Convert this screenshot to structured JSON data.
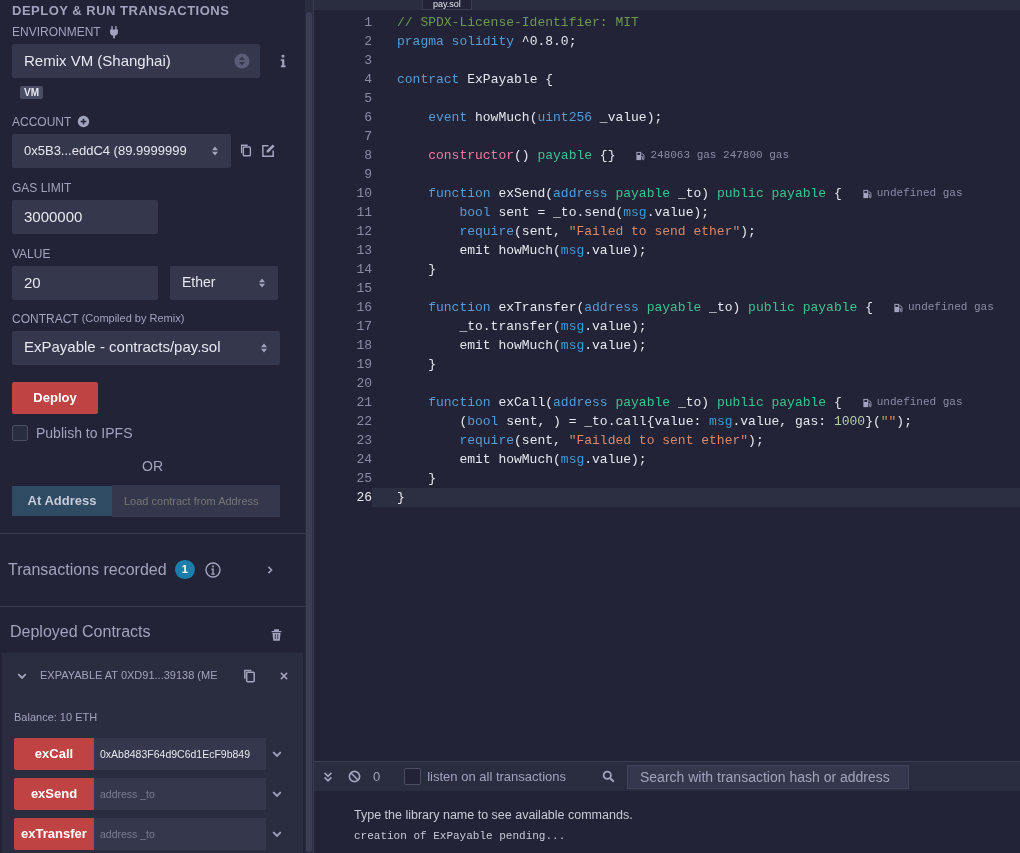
{
  "panel_title": "DEPLOY & RUN TRANSACTIONS",
  "environment": {
    "label": "ENVIRONMENT",
    "value": "Remix VM (Shanghai)",
    "badge": "VM"
  },
  "account": {
    "label": "ACCOUNT",
    "value": "0x5B3...eddC4 (89.9999999"
  },
  "gas_limit": {
    "label": "GAS LIMIT",
    "value": "3000000"
  },
  "value": {
    "label": "VALUE",
    "amount": "20",
    "unit": "Ether"
  },
  "contract": {
    "label": "CONTRACT",
    "note": "(Compiled by Remix)",
    "value": "ExPayable - contracts/pay.sol"
  },
  "deploy_button": "Deploy",
  "publish": {
    "label": "Publish to IPFS",
    "checked": false
  },
  "or_text": "OR",
  "at_address": {
    "button": "At Address",
    "placeholder": "Load contract from Address"
  },
  "transactions_recorded": {
    "label": "Transactions recorded",
    "count": "1"
  },
  "deployed": {
    "title": "Deployed Contracts",
    "instance": {
      "title": "EXPAYABLE AT 0XD91...39138 (ME",
      "expanded": true,
      "balance": "Balance: 10 ETH",
      "functions": [
        {
          "name": "exCall",
          "value": "0xAb8483F64d9C6d1EcF9b849"
        },
        {
          "name": "exSend",
          "placeholder": "address _to"
        },
        {
          "name": "exTransfer",
          "placeholder": "address _to"
        }
      ]
    }
  },
  "tabs": [
    {
      "label": "pay.sol",
      "selected": true
    }
  ],
  "editor": {
    "lines": [
      {
        "number": "1",
        "active": false,
        "tokens": [
          {
            "kind": "comment",
            "text": "// SPDX-License-Identifier: MIT"
          }
        ]
      },
      {
        "number": "2",
        "active": false,
        "tokens": [
          {
            "kind": "kw",
            "text": "pragma"
          },
          {
            "kind": "kw",
            "text": " solidity"
          },
          {
            "kind": "plain",
            "text": " ^0.8.0;"
          }
        ]
      },
      {
        "number": "3",
        "active": false
      },
      {
        "number": "4",
        "active": false,
        "tokens": [
          {
            "kind": "kw",
            "text": "contract"
          },
          {
            "kind": "plain",
            "text": " ExPayable {"
          }
        ]
      },
      {
        "number": "5",
        "active": false
      },
      {
        "number": "6",
        "active": false,
        "tokens": [
          {
            "kind": "kw",
            "text": "    event"
          },
          {
            "kind": "plain",
            "text": " howMuch("
          },
          {
            "kind": "kw",
            "text": "uint256"
          },
          {
            "kind": "plain",
            "text": " _value);"
          }
        ]
      },
      {
        "number": "7",
        "active": false
      },
      {
        "number": "8",
        "active": false,
        "tokens": [
          {
            "kind": "ctor",
            "text": "    constructor"
          },
          {
            "kind": "plain",
            "text": "() "
          },
          {
            "kind": "mod",
            "text": "payable"
          },
          {
            "kind": "plain",
            "text": " {}"
          }
        ],
        "gas": "248063 gas 247800 gas"
      },
      {
        "number": "9",
        "active": false
      },
      {
        "number": "10",
        "active": false,
        "tokens": [
          {
            "kind": "kw",
            "text": "    function"
          },
          {
            "kind": "plain",
            "text": " exSend("
          },
          {
            "kind": "kw",
            "text": "address"
          },
          {
            "kind": "mod",
            "text": " payable"
          },
          {
            "kind": "plain",
            "text": " _to) "
          },
          {
            "kind": "mod",
            "text": "public"
          },
          {
            "kind": "mod",
            "text": " payable"
          },
          {
            "kind": "plain",
            "text": " {"
          }
        ],
        "gas": "undefined gas"
      },
      {
        "number": "11",
        "active": false,
        "tokens": [
          {
            "kind": "kw",
            "text": "        bool"
          },
          {
            "kind": "plain",
            "text": " sent = _to.send("
          },
          {
            "kind": "var",
            "text": "msg"
          },
          {
            "kind": "plain",
            "text": ".value);"
          }
        ]
      },
      {
        "number": "12",
        "active": false,
        "tokens": [
          {
            "kind": "kw",
            "text": "        require"
          },
          {
            "kind": "plain",
            "text": "(sent, "
          },
          {
            "kind": "str",
            "text": "\"Failed to send ether\""
          },
          {
            "kind": "plain",
            "text": ");"
          }
        ]
      },
      {
        "number": "13",
        "active": false,
        "tokens": [
          {
            "kind": "plain",
            "text": "        emit howMuch("
          },
          {
            "kind": "var",
            "text": "msg"
          },
          {
            "kind": "plain",
            "text": ".value);"
          }
        ]
      },
      {
        "number": "14",
        "active": false,
        "tokens": [
          {
            "kind": "plain",
            "text": "    }"
          }
        ]
      },
      {
        "number": "15",
        "active": false
      },
      {
        "number": "16",
        "active": false,
        "tokens": [
          {
            "kind": "kw",
            "text": "    function"
          },
          {
            "kind": "plain",
            "text": " exTransfer("
          },
          {
            "kind": "kw",
            "text": "address"
          },
          {
            "kind": "mod",
            "text": " payable"
          },
          {
            "kind": "plain",
            "text": " _to) "
          },
          {
            "kind": "mod",
            "text": "public"
          },
          {
            "kind": "mod",
            "text": " payable"
          },
          {
            "kind": "plain",
            "text": " {"
          }
        ],
        "gas": "undefined gas"
      },
      {
        "number": "17",
        "active": false,
        "tokens": [
          {
            "kind": "plain",
            "text": "        _to.transfer("
          },
          {
            "kind": "var",
            "text": "msg"
          },
          {
            "kind": "plain",
            "text": ".value);"
          }
        ]
      },
      {
        "number": "18",
        "active": false,
        "tokens": [
          {
            "kind": "plain",
            "text": "        emit howMuch("
          },
          {
            "kind": "var",
            "text": "msg"
          },
          {
            "kind": "plain",
            "text": ".value);"
          }
        ]
      },
      {
        "number": "19",
        "active": false,
        "tokens": [
          {
            "kind": "plain",
            "text": "    }"
          }
        ]
      },
      {
        "number": "20",
        "active": false
      },
      {
        "number": "21",
        "active": false,
        "tokens": [
          {
            "kind": "kw",
            "text": "    function"
          },
          {
            "kind": "plain",
            "text": " exCall("
          },
          {
            "kind": "kw",
            "text": "address"
          },
          {
            "kind": "mod",
            "text": " payable"
          },
          {
            "kind": "plain",
            "text": " _to) "
          },
          {
            "kind": "mod",
            "text": "public"
          },
          {
            "kind": "mod",
            "text": " payable"
          },
          {
            "kind": "plain",
            "text": " {"
          }
        ],
        "gas": "undefined gas"
      },
      {
        "number": "22",
        "active": false,
        "tokens": [
          {
            "kind": "plain",
            "text": "        ("
          },
          {
            "kind": "kw",
            "text": "bool"
          },
          {
            "kind": "plain",
            "text": " sent, ) = _to.call{value: "
          },
          {
            "kind": "var",
            "text": "msg"
          },
          {
            "kind": "plain",
            "text": ".value, gas: "
          },
          {
            "kind": "num",
            "text": "1000"
          },
          {
            "kind": "plain",
            "text": "}("
          },
          {
            "kind": "str",
            "text": "\"\""
          },
          {
            "kind": "plain",
            "text": ");"
          }
        ]
      },
      {
        "number": "23",
        "active": false,
        "tokens": [
          {
            "kind": "kw",
            "text": "        require"
          },
          {
            "kind": "plain",
            "text": "(sent, "
          },
          {
            "kind": "str",
            "text": "\"Failded to sent ether\""
          },
          {
            "kind": "plain",
            "text": ");"
          }
        ]
      },
      {
        "number": "24",
        "active": false,
        "tokens": [
          {
            "kind": "plain",
            "text": "        emit howMuch("
          },
          {
            "kind": "var",
            "text": "msg"
          },
          {
            "kind": "plain",
            "text": ".value);"
          }
        ]
      },
      {
        "number": "25",
        "active": false,
        "tokens": [
          {
            "kind": "plain",
            "text": "    }"
          }
        ]
      },
      {
        "number": "26",
        "active": true,
        "tokens": [
          {
            "kind": "plain",
            "text": "}"
          }
        ]
      }
    ]
  },
  "terminal": {
    "count": "0",
    "listen": {
      "label": "listen on all transactions",
      "checked": false
    },
    "search_placeholder": "Search with transaction hash or address",
    "output": [
      {
        "kind": "info",
        "text": "Type the library name to see available commands."
      },
      {
        "kind": "log",
        "text": "creation of ExPayable pending..."
      }
    ]
  }
}
